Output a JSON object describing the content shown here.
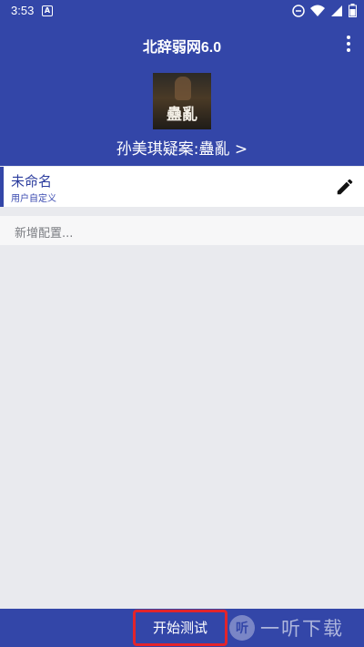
{
  "status_bar": {
    "time": "3:53",
    "notification_letter": "A"
  },
  "header": {
    "title": "北辞弱网6.0",
    "cover_text": "蠱亂",
    "story_link": "孙美琪疑案:蠱亂 >"
  },
  "config": {
    "name": "未命名",
    "subtitle": "用户自定义",
    "add_placeholder": "新增配置..."
  },
  "bottom": {
    "start_label": "开始测试",
    "watermark_icon": "听",
    "watermark_text": "一听下载"
  },
  "colors": {
    "primary": "#3346a8",
    "highlight": "#e3242b",
    "background": "#e9eaee"
  },
  "icons": [
    "do-not-disturb-icon",
    "wifi-icon",
    "signal-icon",
    "battery-icon",
    "more-vert-icon",
    "edit-pencil-icon"
  ]
}
